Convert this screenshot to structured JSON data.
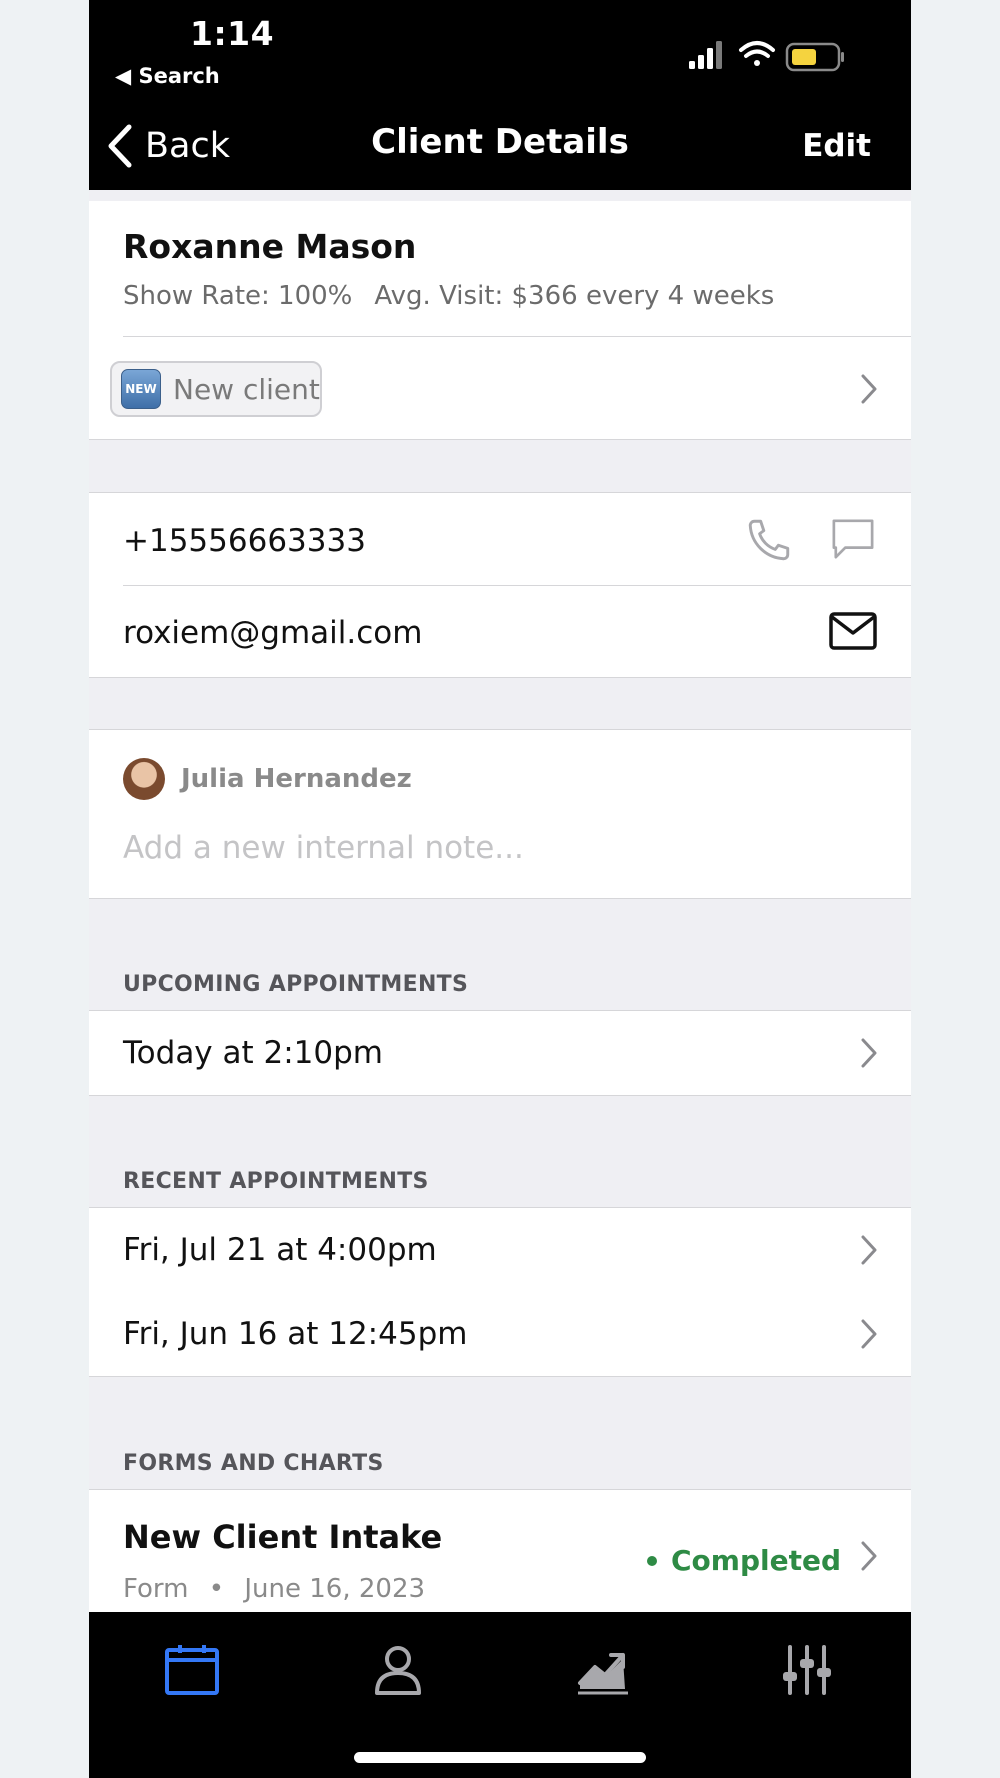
{
  "status_bar": {
    "time": "1:14",
    "back_app": "◀ Search"
  },
  "nav": {
    "back_label": "Back",
    "title": "Client Details",
    "edit_label": "Edit"
  },
  "client": {
    "name": "Roxanne Mason",
    "show_rate": "Show Rate: 100%",
    "avg_visit": "Avg. Visit:  $366 every 4 weeks",
    "tag_badge": "NEW",
    "tag_label": "New client"
  },
  "contact": {
    "phone": "+15556663333",
    "email": "roxiem@gmail.com"
  },
  "note": {
    "author": "Julia Hernandez",
    "placeholder": "Add a new internal note..."
  },
  "upcoming": {
    "header": "UPCOMING APPOINTMENTS",
    "items": [
      "Today at 2:10pm"
    ]
  },
  "recent": {
    "header": "RECENT APPOINTMENTS",
    "items": [
      "Fri, Jul 21 at 4:00pm",
      "Fri, Jun 16 at 12:45pm"
    ]
  },
  "forms": {
    "header": "FORMS AND CHARTS",
    "items": [
      {
        "title": "New Client Intake",
        "type": "Form",
        "date": "June 16, 2023",
        "status": "Completed"
      }
    ]
  },
  "colors": {
    "accent": "#3478f6",
    "completed": "#2e8b45"
  },
  "tabs": [
    {
      "icon": "calendar-icon",
      "active": true
    },
    {
      "icon": "person-icon",
      "active": false
    },
    {
      "icon": "chart-icon",
      "active": false
    },
    {
      "icon": "sliders-icon",
      "active": false
    }
  ]
}
